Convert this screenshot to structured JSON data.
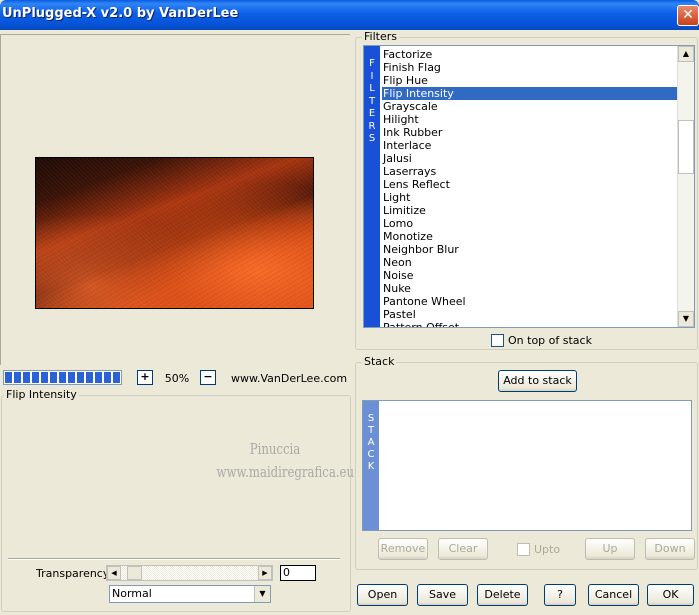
{
  "window": {
    "title": "UnPlugged-X v2.0 by VanDerLee",
    "close_label": "✕"
  },
  "preview": {
    "zoom": "50%",
    "zoom_plus": "+",
    "zoom_minus": "−",
    "site": "www.VanDerLee.com",
    "progress": 1.0
  },
  "params": {
    "group_label": "Flip Intensity",
    "watermark_line1": "Pinuccia",
    "watermark_line2": "www.maidiregrafica.eu",
    "transparency_label": "Transparency",
    "transparency_value": "0",
    "blend_mode": "Normal"
  },
  "filters": {
    "group_label": "Filters",
    "band_letters": [
      "F",
      "I",
      "L",
      "T",
      "E",
      "R",
      "S"
    ],
    "items": [
      "Factorize",
      "Finish Flag",
      "Flip Hue",
      "Flip Intensity",
      "Grayscale",
      "Hilight",
      "Ink Rubber",
      "Interlace",
      "Jalusi",
      "Laserrays",
      "Lens Reflect",
      "Light",
      "Limitize",
      "Lomo",
      "Monotize",
      "Neighbor Blur",
      "Neon",
      "Noise",
      "Nuke",
      "Pantone Wheel",
      "Pastel",
      "Pattern Offset"
    ],
    "selected_index": 3,
    "on_top_label": "On top of stack"
  },
  "stack": {
    "group_label": "Stack",
    "add_label": "Add to stack",
    "band_letters": [
      "S",
      "T",
      "A",
      "C",
      "K"
    ],
    "remove_label": "Remove",
    "clear_label": "Clear",
    "upto_label": "Upto",
    "up_label": "Up",
    "down_label": "Down"
  },
  "footer": {
    "open_label": "Open",
    "save_label": "Save",
    "delete_label": "Delete",
    "help_label": "?",
    "cancel_label": "Cancel",
    "ok_label": "OK"
  }
}
